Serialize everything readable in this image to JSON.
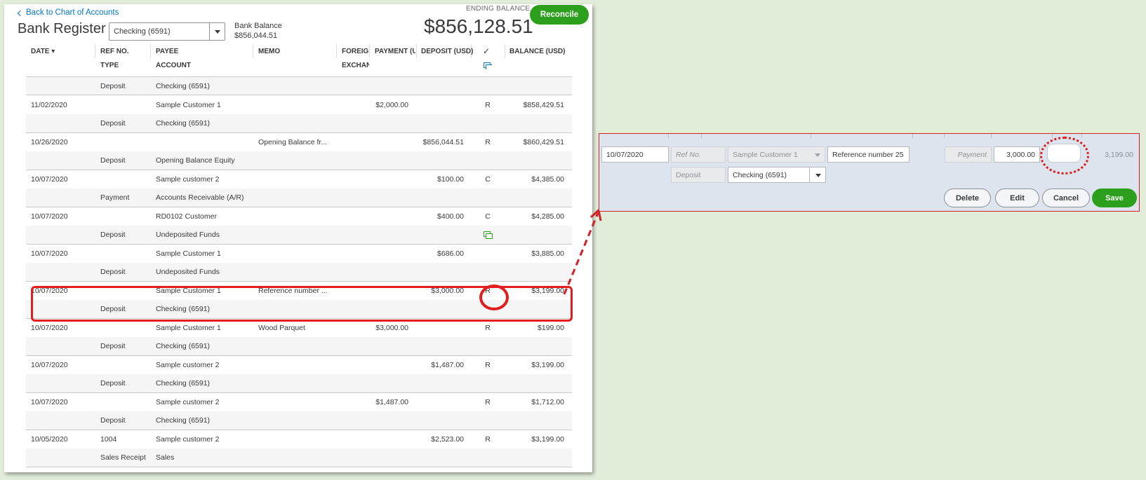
{
  "header": {
    "back_link": "Back to Chart of Accounts",
    "title": "Bank Register",
    "account_selected": "Checking (6591)",
    "bank_balance_label": "Bank Balance",
    "bank_balance_value": "$856,044.51",
    "ending_balance_label": "ENDING BALANCE",
    "ending_balance_value": "$856,128.51",
    "reconcile_label": "Reconcile"
  },
  "columns": {
    "date": "DATE",
    "ref_no": "REF NO.",
    "type": "TYPE",
    "payee": "PAYEE",
    "account": "ACCOUNT",
    "memo": "MEMO",
    "foreign": "FOREIGN",
    "exchange": "EXCHAN",
    "payment": "PAYMENT (US",
    "deposit": "DEPOSIT (USD)",
    "check": "✓",
    "balance": "BALANCE (USD)"
  },
  "rows": [
    {
      "date": "",
      "ref": "",
      "type": "Deposit",
      "payee": "",
      "account": "Checking (6591)",
      "memo": "",
      "payment": "",
      "deposit": "",
      "status": "",
      "balance": "",
      "attach": false
    },
    {
      "date": "11/02/2020",
      "ref": "",
      "type": "Deposit",
      "payee": "Sample Customer 1",
      "account": "Checking (6591)",
      "memo": "",
      "payment": "$2,000.00",
      "deposit": "",
      "status": "R",
      "balance": "$858,429.51",
      "attach": false
    },
    {
      "date": "10/26/2020",
      "ref": "",
      "type": "Deposit",
      "payee": "",
      "account": "Opening Balance Equity",
      "memo": "Opening Balance fr...",
      "payment": "",
      "deposit": "$856,044.51",
      "status": "R",
      "balance": "$860,429.51",
      "attach": false
    },
    {
      "date": "10/07/2020",
      "ref": "",
      "type": "Payment",
      "payee": "Sample customer 2",
      "account": "Accounts Receivable (A/R)",
      "memo": "",
      "payment": "",
      "deposit": "$100.00",
      "status": "C",
      "balance": "$4,385.00",
      "attach": false
    },
    {
      "date": "10/07/2020",
      "ref": "",
      "type": "Deposit",
      "payee": "RD0102 Customer",
      "account": "Undeposited Funds",
      "memo": "",
      "payment": "",
      "deposit": "$400.00",
      "status": "C",
      "balance": "$4,285.00",
      "attach": true
    },
    {
      "date": "10/07/2020",
      "ref": "",
      "type": "Deposit",
      "payee": "Sample Customer 1",
      "account": "Undeposited Funds",
      "memo": "",
      "payment": "",
      "deposit": "$686.00",
      "status": "",
      "balance": "$3,885.00",
      "attach": false
    },
    {
      "date": "10/07/2020",
      "ref": "",
      "type": "Deposit",
      "payee": "Sample Customer 1",
      "account": "Checking (6591)",
      "memo": "Reference number ...",
      "payment": "",
      "deposit": "$3,000.00",
      "status": "R",
      "balance": "$3,199.00",
      "attach": false
    },
    {
      "date": "10/07/2020",
      "ref": "",
      "type": "Deposit",
      "payee": "Sample Customer 1",
      "account": "Checking (6591)",
      "memo": "Wood Parquet",
      "payment": "$3,000.00",
      "deposit": "",
      "status": "R",
      "balance": "$199.00",
      "attach": false
    },
    {
      "date": "10/07/2020",
      "ref": "",
      "type": "Deposit",
      "payee": "Sample customer 2",
      "account": "Checking (6591)",
      "memo": "",
      "payment": "",
      "deposit": "$1,487.00",
      "status": "R",
      "balance": "$3,199.00",
      "attach": false
    },
    {
      "date": "10/07/2020",
      "ref": "",
      "type": "Deposit",
      "payee": "Sample customer 2",
      "account": "Checking (6591)",
      "memo": "",
      "payment": "$1,487.00",
      "deposit": "",
      "status": "R",
      "balance": "$1,712.00",
      "attach": false
    },
    {
      "date": "10/05/2020",
      "ref": "1004",
      "type": "Sales Receipt",
      "payee": "Sample customer 2",
      "account": "Sales",
      "memo": "",
      "payment": "",
      "deposit": "$2,523.00",
      "status": "R",
      "balance": "$3,199.00",
      "attach": false
    }
  ],
  "edit_panel": {
    "date": "10/07/2020",
    "ref_placeholder": "Ref No.",
    "payee": "Sample Customer 1",
    "memo": "Reference number 25",
    "payment_placeholder": "Payment",
    "deposit": "3,000.00",
    "status": "",
    "balance": "3,199.00",
    "type": "Deposit",
    "account": "Checking (6591)",
    "delete_label": "Delete",
    "edit_label": "Edit",
    "cancel_label": "Cancel",
    "save_label": "Save"
  },
  "colors": {
    "accent_green": "#2ca01c",
    "link_blue": "#0077c5",
    "annotation_red": "#e21d1d"
  }
}
